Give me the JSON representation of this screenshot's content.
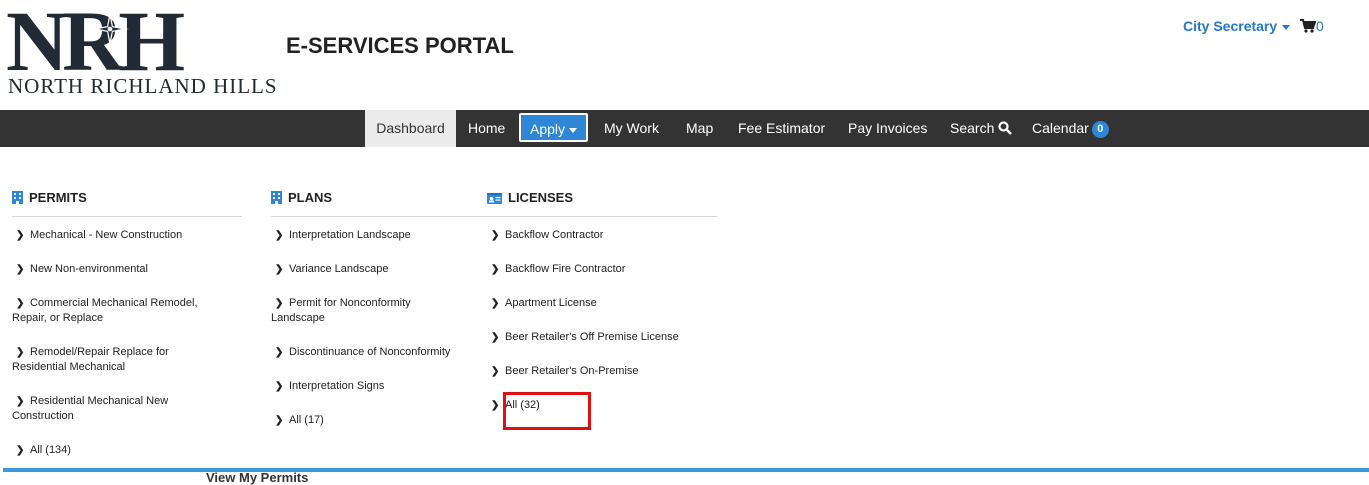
{
  "header": {
    "logo_letters": "NRH",
    "logo_subtitle": "NORTH RICHLAND HILLS",
    "portal_title": "E-SERVICES PORTAL",
    "user_menu_label": "City Secretary",
    "cart_count": "0"
  },
  "nav": {
    "items": {
      "dashboard": "Dashboard",
      "home": "Home",
      "apply": "Apply",
      "my_work": "My Work",
      "map": "Map",
      "fee_estimator": "Fee Estimator",
      "pay_invoices": "Pay Invoices",
      "search": "Search",
      "calendar": "Calendar"
    },
    "calendar_badge": "0"
  },
  "apply_menu": {
    "permits": {
      "heading": "PERMITS",
      "items": [
        "Mechanical - New Construction",
        "New Non-environmental",
        "Commercial Mechanical Remodel, Repair, or Replace",
        "Remodel/Repair Replace for Residential Mechanical",
        "Residential Mechanical New Construction",
        "All (134)"
      ]
    },
    "plans": {
      "heading": "PLANS",
      "items": [
        "Interpretation Landscape",
        "Variance Landscape",
        "Permit for Nonconformity Landscape",
        "Discontinuance of Nonconformity",
        "Interpretation Signs",
        "All (17)"
      ]
    },
    "licenses": {
      "heading": "LICENSES",
      "items": [
        "Backflow Contractor",
        "Backflow Fire Contractor",
        "Apartment License",
        "Beer Retailer's Off Premise License",
        "Beer Retailer's On-Premise",
        "All (32)"
      ]
    }
  },
  "footer": {
    "clipped_link": "View My Permits"
  },
  "colors": {
    "accent": "#2d86d6",
    "navbar": "#333333",
    "highlight": "#e01010",
    "link": "#2477c9"
  }
}
